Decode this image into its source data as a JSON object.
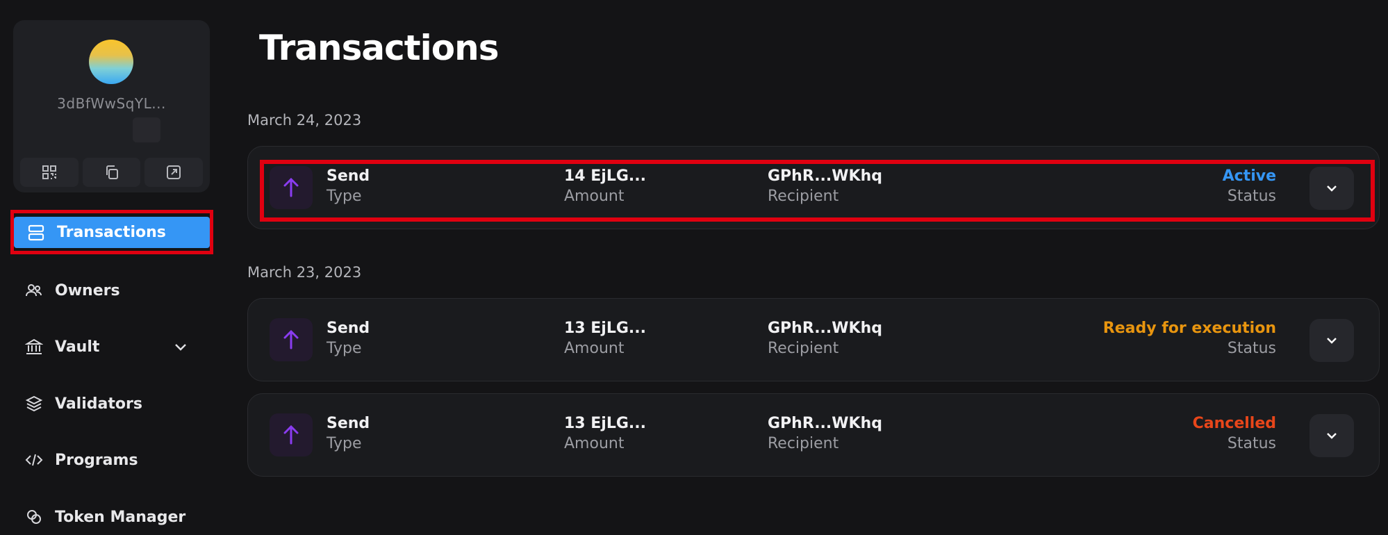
{
  "sidebar": {
    "wallet_address": "3dBfWwSqYL...",
    "wallet_actions": [
      {
        "icon": "qr-code-icon"
      },
      {
        "icon": "copy-icon"
      },
      {
        "icon": "external-link-icon"
      }
    ],
    "nav": [
      {
        "label": "Transactions",
        "icon": "transactions-icon",
        "active": true
      },
      {
        "label": "Owners",
        "icon": "owners-icon"
      },
      {
        "label": "Vault",
        "icon": "bank-icon",
        "expandable": true
      },
      {
        "label": "Validators",
        "icon": "layers-icon"
      },
      {
        "label": "Programs",
        "icon": "code-icon"
      },
      {
        "label": "Token Manager",
        "icon": "coins-icon"
      }
    ]
  },
  "main": {
    "title": "Transactions",
    "groups": [
      {
        "date": "March 24, 2023",
        "transactions": [
          {
            "type": "Send",
            "type_label": "Type",
            "amount": "14 EjLG...",
            "amount_label": "Amount",
            "recipient": "GPhR...WKhq",
            "recipient_label": "Recipient",
            "status": "Active",
            "status_label": "Status",
            "status_color": "#3596f5"
          }
        ]
      },
      {
        "date": "March 23, 2023",
        "transactions": [
          {
            "type": "Send",
            "type_label": "Type",
            "amount": "13 EjLG...",
            "amount_label": "Amount",
            "recipient": "GPhR...WKhq",
            "recipient_label": "Recipient",
            "status": "Ready for execution",
            "status_label": "Status",
            "status_color": "#e8950f"
          },
          {
            "type": "Send",
            "type_label": "Type",
            "amount": "13 EjLG...",
            "amount_label": "Amount",
            "recipient": "GPhR...WKhq",
            "recipient_label": "Recipient",
            "status": "Cancelled",
            "status_label": "Status",
            "status_color": "#e8461a"
          }
        ]
      }
    ]
  },
  "colors": {
    "accent": "#3596f5",
    "send_arrow": "#8a3cf0",
    "highlight": "#e00010"
  }
}
